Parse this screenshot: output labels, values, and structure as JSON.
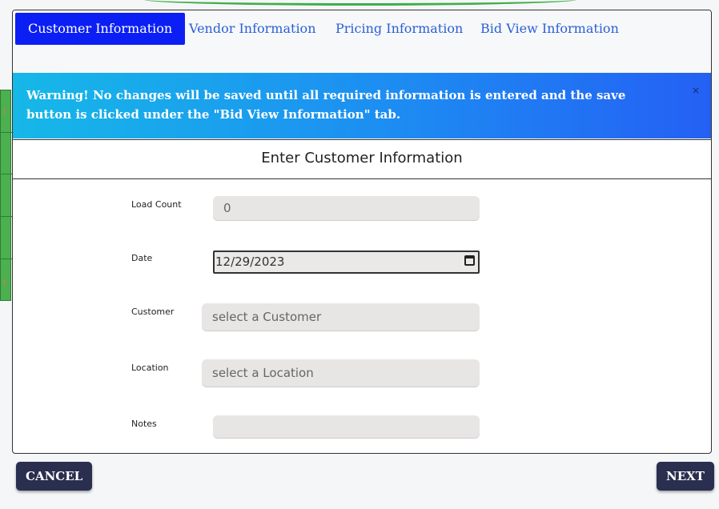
{
  "tabs": [
    {
      "label": "Customer Information",
      "active": true
    },
    {
      "label": "Vendor Information",
      "active": false
    },
    {
      "label": "Pricing Information",
      "active": false
    },
    {
      "label": "Bid View Information",
      "active": false
    }
  ],
  "warning": {
    "text": "Warning! No changes will be saved until all required information is entered and the save button is clicked under the \"Bid View Information\" tab.",
    "close_label": "×"
  },
  "section_title": "Enter Customer Information",
  "form": {
    "load_count": {
      "label": "Load Count",
      "value": "0"
    },
    "date": {
      "label": "Date",
      "value": "12/29/2023"
    },
    "customer": {
      "label": "Customer",
      "placeholder": "select a Customer"
    },
    "location": {
      "label": "Location",
      "placeholder": "select a Location"
    },
    "notes": {
      "label": "Notes",
      "value": ""
    }
  },
  "buttons": {
    "cancel": "CANCEL",
    "next": "NEXT"
  },
  "colors": {
    "active_tab": "#0b1ff5",
    "tab_link": "#2a5fd6",
    "button": "#2a2e4f",
    "side_strip": "#4caf50"
  }
}
